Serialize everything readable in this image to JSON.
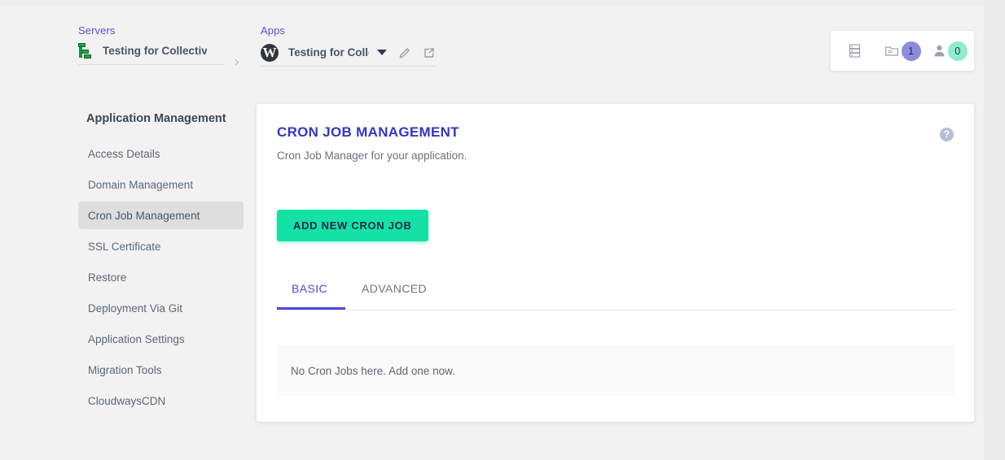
{
  "breadcrumbs": {
    "servers": {
      "label": "Servers",
      "name": "Testing for CollectiveR",
      "icon": "server-stack-icon"
    },
    "separator": "›",
    "apps": {
      "label": "Apps",
      "name": "Testing for CollectiveRay",
      "icon": "wordpress-icon",
      "dropdown_icon": "chevron-down-icon",
      "edit_icon": "pencil-icon",
      "open_icon": "external-link-icon"
    }
  },
  "counters": {
    "servers_icon": "server-rack-icon",
    "projects_icon": "folder-icon",
    "projects_count": "1",
    "team_icon": "user-icon",
    "team_count": "0",
    "badge_purple": "#8b8ce0",
    "badge_green": "#8eeccf"
  },
  "sidebar": {
    "title": "Application Management",
    "items": [
      {
        "label": "Access Details",
        "active": false
      },
      {
        "label": "Domain Management",
        "active": false
      },
      {
        "label": "Cron Job Management",
        "active": true
      },
      {
        "label": "SSL Certificate",
        "active": false
      },
      {
        "label": "Restore",
        "active": false
      },
      {
        "label": "Deployment Via Git",
        "active": false
      },
      {
        "label": "Application Settings",
        "active": false
      },
      {
        "label": "Migration Tools",
        "active": false
      },
      {
        "label": "CloudwaysCDN",
        "active": false
      }
    ]
  },
  "card": {
    "title": "CRON JOB MANAGEMENT",
    "title_color": "#3434c8",
    "subtitle": "Cron Job Manager for your application.",
    "help_icon": "help-circle-icon",
    "help_glyph": "?",
    "add_button": "ADD NEW CRON JOB",
    "add_button_color": "#14e2a4",
    "tabs": [
      {
        "label": "BASIC",
        "active": true
      },
      {
        "label": "ADVANCED",
        "active": false
      }
    ],
    "empty_state": "No Cron Jobs here. Add one now."
  }
}
